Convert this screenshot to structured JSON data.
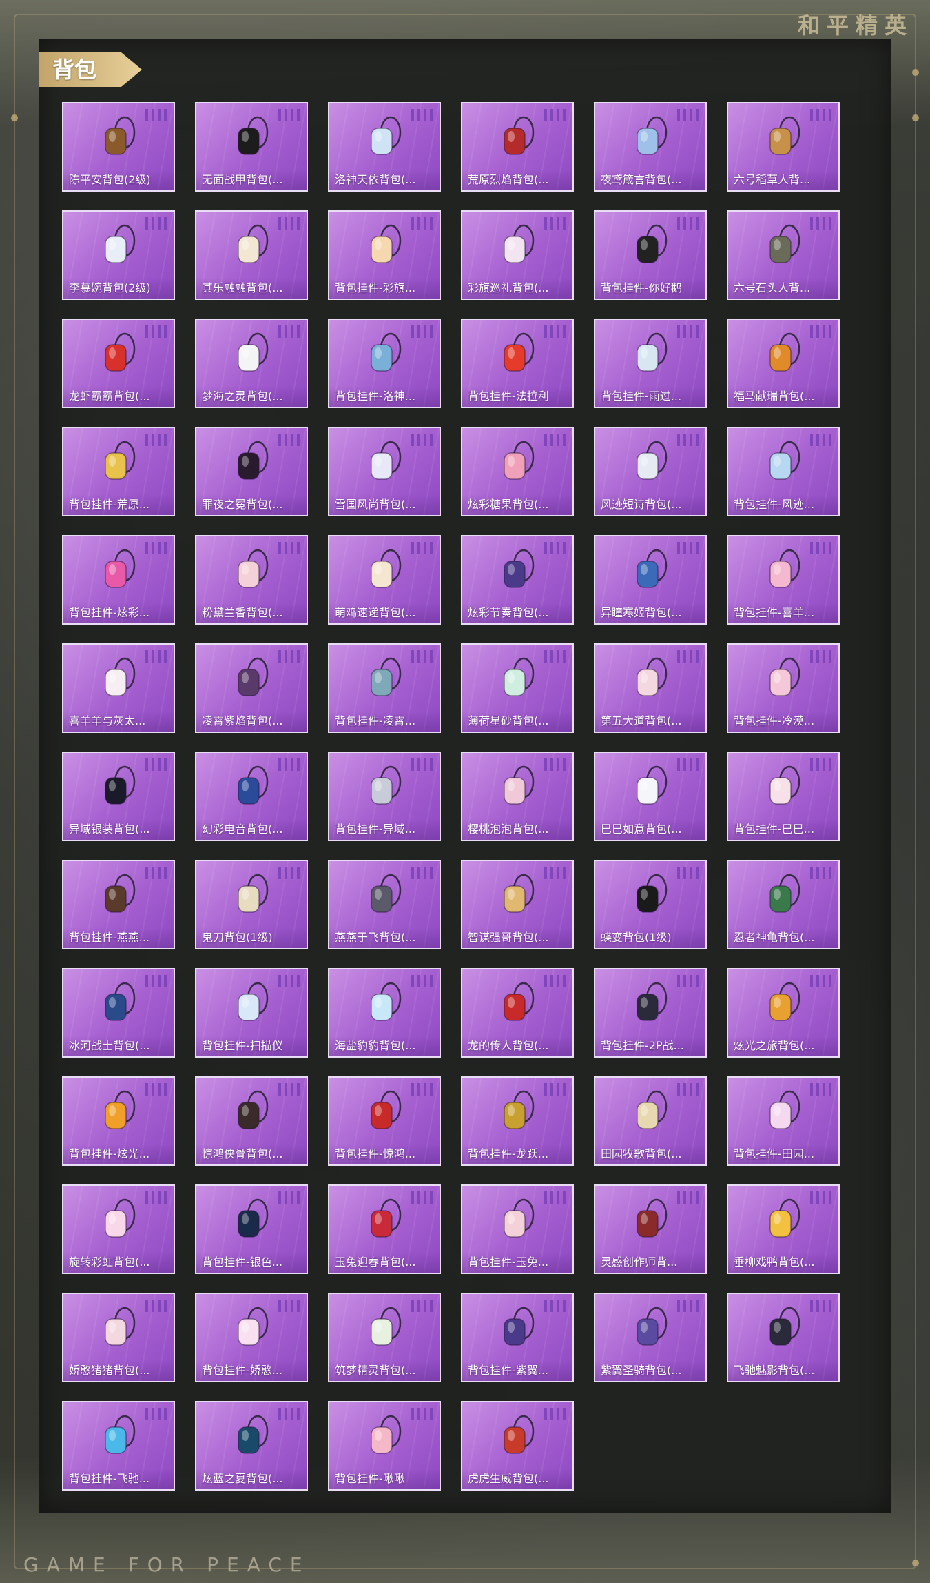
{
  "brand": {
    "title_cn": "和平精英",
    "title_en": "GAME FOR PEACE"
  },
  "section": {
    "title": "背包"
  },
  "colors": {
    "card_purple": "#a55fd0",
    "tag_gold": "#d8bd83"
  },
  "items": [
    {
      "name": "陈平安背包(2级)",
      "icon": "woven-basket-backpack",
      "color": "#8b5a2b"
    },
    {
      "name": "无面战甲背包(...",
      "icon": "armor-backpack",
      "color": "#1c1c1c"
    },
    {
      "name": "洛神天依背包(...",
      "icon": "fairy-backpack",
      "color": "#cfe3f5"
    },
    {
      "name": "荒原烈焰背包(...",
      "icon": "flame-backpack",
      "color": "#b52a2a"
    },
    {
      "name": "夜鸢箴言背包(...",
      "icon": "night-kite-backpack",
      "color": "#9fc0e8"
    },
    {
      "name": "六号稻草人背...",
      "icon": "scarecrow-backpack",
      "color": "#c8914a"
    },
    {
      "name": "李慕婉背包(2级)",
      "icon": "bunny-backpack",
      "color": "#e8eef8"
    },
    {
      "name": "其乐融融背包(...",
      "icon": "rabbit-backpack",
      "color": "#f3e6d2"
    },
    {
      "name": "背包挂件-彩旗...",
      "icon": "ice-cream-charm",
      "color": "#f5d7b0"
    },
    {
      "name": "彩旗巡礼背包(...",
      "icon": "bunny-flag-backpack",
      "color": "#f2e4f0"
    },
    {
      "name": "背包挂件-你好鹅",
      "icon": "penguin-charm",
      "color": "#222222"
    },
    {
      "name": "六号石头人背...",
      "icon": "stone-golem-backpack",
      "color": "#6b6b5a"
    },
    {
      "name": "龙虾霸霸背包(...",
      "icon": "lobster-backpack",
      "color": "#d8302a"
    },
    {
      "name": "梦海之灵背包(...",
      "icon": "spirit-backpack",
      "color": "#f4f4f6"
    },
    {
      "name": "背包挂件-洛神...",
      "icon": "ribbon-charm",
      "color": "#7ab0d8"
    },
    {
      "name": "背包挂件-法拉利",
      "icon": "ferrari-charm",
      "color": "#e63a2a"
    },
    {
      "name": "背包挂件-雨过...",
      "icon": "umbrella-charm",
      "color": "#d8e6f2"
    },
    {
      "name": "福马献瑞背包(...",
      "icon": "horse-backpack",
      "color": "#e08a2a"
    },
    {
      "name": "背包挂件-荒原...",
      "icon": "sun-charm",
      "color": "#e8c24a"
    },
    {
      "name": "罪夜之冕背包(...",
      "icon": "bat-backpack",
      "color": "#2a1a2e"
    },
    {
      "name": "雪国风尚背包(...",
      "icon": "snow-bunny-backpack",
      "color": "#e8e8f8"
    },
    {
      "name": "炫彩糖果背包(...",
      "icon": "donut-backpack",
      "color": "#f0a0b8"
    },
    {
      "name": "风迹短诗背包(...",
      "icon": "poem-bag-backpack",
      "color": "#e6eaf2"
    },
    {
      "name": "背包挂件-风迹...",
      "icon": "bag-charm",
      "color": "#b8d8f2"
    },
    {
      "name": "背包挂件-炫彩...",
      "icon": "candy-charm",
      "color": "#e85aa8"
    },
    {
      "name": "粉黛兰香背包(...",
      "icon": "pink-bunny-backpack",
      "color": "#f4d0d8"
    },
    {
      "name": "萌鸡速递背包(...",
      "icon": "chick-backpack",
      "color": "#f4e6d0"
    },
    {
      "name": "炫彩节奏背包(...",
      "icon": "rhythm-backpack",
      "color": "#4a3a8a"
    },
    {
      "name": "异瞳寒姬背包(...",
      "icon": "ice-backpack",
      "color": "#3a6ab8"
    },
    {
      "name": "背包挂件-喜羊...",
      "icon": "bow-charm",
      "color": "#f4b8d0"
    },
    {
      "name": "喜羊羊与灰太...",
      "icon": "sheep-backpack",
      "color": "#f6eef2"
    },
    {
      "name": "凌霄紫焰背包(...",
      "icon": "purple-flame-backpack",
      "color": "#5a3a6a"
    },
    {
      "name": "背包挂件-凌霄...",
      "icon": "swirl-charm",
      "color": "#7fa8b8"
    },
    {
      "name": "薄荷星砂背包(...",
      "icon": "mint-backpack",
      "color": "#cfeee0"
    },
    {
      "name": "第五大道背包(...",
      "icon": "fashion-backpack",
      "color": "#f4d8e0"
    },
    {
      "name": "背包挂件-冷漠...",
      "icon": "flower-charm",
      "color": "#f4c8d8"
    },
    {
      "name": "异域银装背包(...",
      "icon": "silver-backpack",
      "color": "#1a1a2a"
    },
    {
      "name": "幻彩电音背包(...",
      "icon": "electro-backpack",
      "color": "#2a4a9a"
    },
    {
      "name": "背包挂件-异域...",
      "icon": "crown-charm",
      "color": "#c8ccd8"
    },
    {
      "name": "樱桃泡泡背包(...",
      "icon": "bow-backpack",
      "color": "#f0c8d8"
    },
    {
      "name": "巳巳如意背包(...",
      "icon": "snake-backpack",
      "color": "#f4f6fa"
    },
    {
      "name": "背包挂件-巳巳...",
      "icon": "snake-charm",
      "color": "#f8e0e8"
    },
    {
      "name": "背包挂件-燕燕...",
      "icon": "swallow-charm",
      "color": "#5a3a2a"
    },
    {
      "name": "鬼刀背包(1级)",
      "icon": "ghost-blade-backpack",
      "color": "#e8dcc0"
    },
    {
      "name": "燕燕于飞背包(...",
      "icon": "headphone-backpack",
      "color": "#5a5a6a"
    },
    {
      "name": "智谋强哥背包(...",
      "icon": "bear-backpack",
      "color": "#e0b870"
    },
    {
      "name": "蝶变背包(1级)",
      "icon": "butterfly-backpack",
      "color": "#1a1a1a"
    },
    {
      "name": "忍者神龟背包(...",
      "icon": "ninja-turtle-backpack",
      "color": "#3a7a4a"
    },
    {
      "name": "冰河战士背包(...",
      "icon": "glacier-backpack",
      "color": "#2a4a8a"
    },
    {
      "name": "背包挂件-扫描仪",
      "icon": "scanner-charm",
      "color": "#d8e8f8"
    },
    {
      "name": "海盐豹豹背包(...",
      "icon": "seal-backpack",
      "color": "#c8e8f8"
    },
    {
      "name": "龙的传人背包(...",
      "icon": "dragon-heir-backpack",
      "color": "#c82a2a"
    },
    {
      "name": "背包挂件-2P战...",
      "icon": "blade-charm",
      "color": "#2a2a3a"
    },
    {
      "name": "炫光之旅背包(...",
      "icon": "travel-backpack",
      "color": "#e8a030"
    },
    {
      "name": "背包挂件-炫光...",
      "icon": "gourd-charm",
      "color": "#f0a028"
    },
    {
      "name": "惊鸿侠骨背包(...",
      "icon": "knight-backpack",
      "color": "#3a2a2a"
    },
    {
      "name": "背包挂件-惊鸿...",
      "icon": "tassel-charm",
      "color": "#c82a2a"
    },
    {
      "name": "背包挂件-龙跃...",
      "icon": "lion-charm",
      "color": "#c8a030"
    },
    {
      "name": "田园牧歌背包(...",
      "icon": "picnic-basket-backpack",
      "color": "#e8d8b0"
    },
    {
      "name": "背包挂件-田园...",
      "icon": "card-charm",
      "color": "#f4d8f0"
    },
    {
      "name": "旋转彩虹背包(...",
      "icon": "rainbow-backpack",
      "color": "#f8d8e8"
    },
    {
      "name": "背包挂件-银色...",
      "icon": "silver-charm",
      "color": "#1a2a4a"
    },
    {
      "name": "玉兔迎春背包(...",
      "icon": "jade-rabbit-backpack",
      "color": "#c82a3a"
    },
    {
      "name": "背包挂件-玉兔...",
      "icon": "rabbit-charm",
      "color": "#f4d0d8"
    },
    {
      "name": "灵感创作师背...",
      "icon": "creator-backpack",
      "color": "#8a2a2a"
    },
    {
      "name": "垂柳戏鸭背包(...",
      "icon": "duck-backpack",
      "color": "#f4c040"
    },
    {
      "name": "娇憨猪猪背包(...",
      "icon": "pig-backpack",
      "color": "#f4d8e0"
    },
    {
      "name": "背包挂件-娇憨...",
      "icon": "pig-charm",
      "color": "#f8e0f0"
    },
    {
      "name": "筑梦精灵背包(...",
      "icon": "dream-spirit-backpack",
      "color": "#e8f0e0"
    },
    {
      "name": "背包挂件-紫翼...",
      "icon": "wing-charm",
      "color": "#4a3a8a"
    },
    {
      "name": "紫翼圣骑背包(...",
      "icon": "paladin-backpack",
      "color": "#5a4aa0"
    },
    {
      "name": "飞驰魅影背包(...",
      "icon": "racer-backpack",
      "color": "#2a2a3a"
    },
    {
      "name": "背包挂件-飞驰...",
      "icon": "eye-charm",
      "color": "#4ab8e8"
    },
    {
      "name": "炫蓝之夏背包(...",
      "icon": "summer-backpack",
      "color": "#1a4a6a"
    },
    {
      "name": "背包挂件-啾啾",
      "icon": "chick-charm",
      "color": "#f4b8c8"
    },
    {
      "name": "虎虎生威背包(...",
      "icon": "tiger-backpack",
      "color": "#c83a2a"
    }
  ]
}
